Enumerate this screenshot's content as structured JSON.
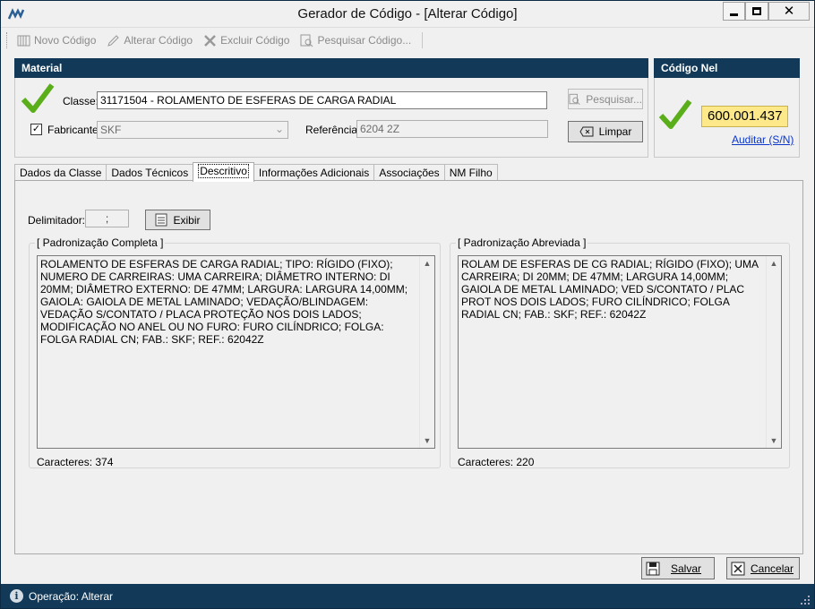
{
  "window": {
    "title": "Gerador de Código - [Alterar Código]"
  },
  "toolbar": {
    "novo": "Novo Código",
    "alterar": "Alterar Código",
    "excluir": "Excluir Código",
    "pesquisar": "Pesquisar Código..."
  },
  "material": {
    "header": "Material",
    "classe_label": "Classe:",
    "classe_value": "31171504 - ROLAMENTO DE ESFERAS DE CARGA RADIAL",
    "fabricante_label": "Fabricante:",
    "fabricante_checked": true,
    "fabricante_value": "SKF",
    "referencia_label": "Referência:",
    "referencia_value": "6204 2Z",
    "pesquisar_button": "Pesquisar...",
    "limpar_button": "Limpar"
  },
  "codigo_nel": {
    "header": "Código Nel",
    "code": "600.001.437",
    "auditar_link": "Auditar (S/N)"
  },
  "tabs": [
    {
      "label": "Dados da Classe",
      "active": false
    },
    {
      "label": "Dados Técnicos",
      "active": false
    },
    {
      "label": "Descritivo",
      "active": true
    },
    {
      "label": "Informações Adicionais",
      "active": false
    },
    {
      "label": "Associações",
      "active": false
    },
    {
      "label": "NM Filho",
      "active": false
    }
  ],
  "descritivo": {
    "delimitador_label": "Delimitador:",
    "delimitador_value": ";",
    "exibir_button": "Exibir",
    "completa": {
      "title": "[ Padronização Completa ]",
      "text": "ROLAMENTO DE ESFERAS DE CARGA RADIAL; TIPO: RÍGIDO (FIXO); NUMERO DE CARREIRAS: UMA CARREIRA; DIÂMETRO INTERNO: DI 20MM; DIÂMETRO EXTERNO: DE 47MM; LARGURA: LARGURA 14,00MM; GAIOLA: GAIOLA DE METAL LAMINADO; VEDAÇÃO/BLINDAGEM: VEDAÇÃO S/CONTATO / PLACA PROTEÇÃO NOS DOIS LADOS; MODIFICAÇÃO NO ANEL OU NO FURO: FURO CILÍNDRICO; FOLGA: FOLGA RADIAL CN; FAB.: SKF; REF.: 62042Z",
      "chars": "Caracteres: 374"
    },
    "abreviada": {
      "title": "[ Padronização Abreviada ]",
      "text": "ROLAM DE ESFERAS DE CG RADIAL; RÍGIDO (FIXO); UMA CARREIRA; DI 20MM; DE 47MM; LARGURA 14,00MM; GAIOLA DE METAL LAMINADO; VED S/CONTATO / PLAC PROT NOS DOIS LADOS; FURO CILÍNDRICO; FOLGA RADIAL CN; FAB.: SKF; REF.: 62042Z",
      "chars": "Caracteres: 220"
    }
  },
  "footer": {
    "salvar": "Salvar",
    "cancelar": "Cancelar"
  },
  "status": {
    "text": "Operação: Alterar"
  },
  "colors": {
    "panel_header": "#123a58",
    "code_highlight": "#fde98a",
    "link": "#0b36c8",
    "check_green": "#5aae1a"
  },
  "icons": [
    "app-icon",
    "minimize-icon",
    "maximize-icon",
    "close-icon",
    "new-doc-icon",
    "pencil-icon",
    "x-delete-icon",
    "search-doc-icon",
    "green-check-icon",
    "clear-icon",
    "list-icon",
    "save-icon",
    "cancel-icon",
    "info-icon",
    "resize-grip-icon"
  ]
}
